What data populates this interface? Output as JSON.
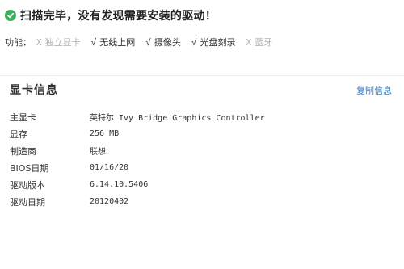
{
  "status": {
    "icon": "check-circle-icon",
    "icon_color": "#3cae5c",
    "text": "扫描完毕，没有发现需要安装的驱动！"
  },
  "features": {
    "label": "功能：",
    "items": [
      {
        "mark": "X",
        "name": "独立显卡",
        "present": false
      },
      {
        "mark": "√",
        "name": "无线上网",
        "present": true
      },
      {
        "mark": "√",
        "name": "摄像头",
        "present": true
      },
      {
        "mark": "√",
        "name": "光盘刻录",
        "present": true
      },
      {
        "mark": "X",
        "name": "蓝牙",
        "present": false
      }
    ]
  },
  "section": {
    "title": "显卡信息",
    "copy_label": "复制信息",
    "link_color": "#2f7dc4"
  },
  "info": {
    "rows": [
      {
        "key": "主显卡",
        "value": "英特尔 Ivy Bridge Graphics Controller"
      },
      {
        "key": "显存",
        "value": "256 MB"
      },
      {
        "key": "制造商",
        "value": "联想"
      },
      {
        "key": "BIOS日期",
        "value": "01/16/20"
      },
      {
        "key": "驱动版本",
        "value": "6.14.10.5406"
      },
      {
        "key": "驱动日期",
        "value": "20120402"
      }
    ]
  }
}
